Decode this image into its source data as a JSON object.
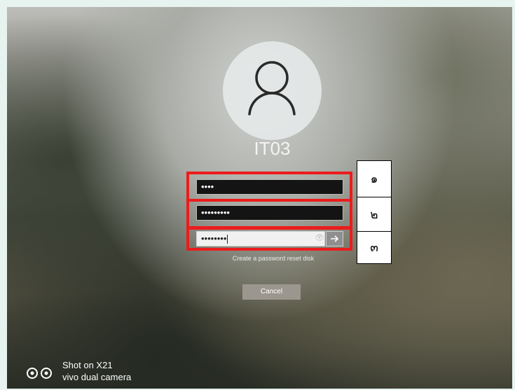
{
  "login": {
    "username": "IT03",
    "fields": [
      {
        "masked_value": "••••"
      },
      {
        "masked_value": "•••••••••"
      },
      {
        "masked_value": "••••••••"
      }
    ],
    "reset_link": "Create a password reset disk",
    "cancel_label": "Cancel"
  },
  "annotations": {
    "labels": [
      "๑",
      "๒",
      "๓"
    ],
    "highlight_color": "#ec1c1c"
  },
  "icons": {
    "avatar": "user-icon",
    "reveal": "eye-icon",
    "submit": "arrow-right-icon",
    "camera_logo": "camera-logo-icon"
  },
  "watermark": {
    "line1": "Shot on X21",
    "line2": "vivo dual camera"
  }
}
